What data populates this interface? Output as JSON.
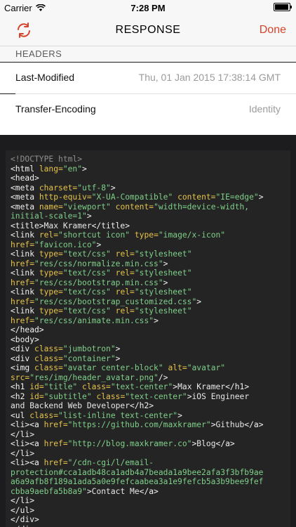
{
  "status_bar": {
    "carrier": "Carrier",
    "time": "7:28 PM"
  },
  "nav": {
    "title": "RESPONSE",
    "done_label": "Done"
  },
  "section": {
    "headers_label": "HEADERS"
  },
  "headers": [
    {
      "key": "Last-Modified",
      "value": "Thu, 01 Jan 2015 17:38:14 GMT"
    },
    {
      "key": "Transfer-Encoding",
      "value": "Identity"
    }
  ],
  "code_lines": [
    [
      [
        "<!DOCTYPE html>",
        "grey"
      ]
    ],
    [
      [
        "<html ",
        "tag"
      ],
      [
        "lang=",
        "attr"
      ],
      [
        "\"en\"",
        "str"
      ],
      [
        ">",
        "tag"
      ]
    ],
    [
      [
        "<head>",
        "tag"
      ]
    ],
    [
      [
        "<meta ",
        "tag"
      ],
      [
        "charset=",
        "attr"
      ],
      [
        "\"utf-8\"",
        "str"
      ],
      [
        ">",
        "tag"
      ]
    ],
    [
      [
        "<meta ",
        "tag"
      ],
      [
        "http-equiv=",
        "attr"
      ],
      [
        "\"X-UA-Compatible\" ",
        "str"
      ],
      [
        "content=",
        "attr"
      ],
      [
        "\"IE=edge\"",
        "str"
      ],
      [
        ">",
        "tag"
      ]
    ],
    [
      [
        "<meta ",
        "tag"
      ],
      [
        "name=",
        "attr"
      ],
      [
        "\"viewport\" ",
        "str"
      ],
      [
        "content=",
        "attr"
      ],
      [
        "\"width=device-width,",
        "str"
      ]
    ],
    [
      [
        "initial-scale=1\"",
        "str"
      ],
      [
        ">",
        "tag"
      ]
    ],
    [
      [
        "<title>",
        "tag"
      ],
      [
        "Max Kramer",
        "text"
      ],
      [
        "</title>",
        "tag"
      ]
    ],
    [
      [
        "<link ",
        "tag"
      ],
      [
        "rel=",
        "attr"
      ],
      [
        "\"shortcut icon\" ",
        "str"
      ],
      [
        "type=",
        "attr"
      ],
      [
        "\"image/x-icon\"",
        "str"
      ]
    ],
    [
      [
        "href=",
        "attr"
      ],
      [
        "\"favicon.ico\"",
        "str"
      ],
      [
        ">",
        "tag"
      ]
    ],
    [
      [
        "<link ",
        "tag"
      ],
      [
        "type=",
        "attr"
      ],
      [
        "\"text/css\" ",
        "str"
      ],
      [
        "rel=",
        "attr"
      ],
      [
        "\"stylesheet\"",
        "str"
      ]
    ],
    [
      [
        "href=",
        "attr"
      ],
      [
        "\"res/css/normalize.min.css\"",
        "str"
      ],
      [
        ">",
        "tag"
      ]
    ],
    [
      [
        "<link ",
        "tag"
      ],
      [
        "type=",
        "attr"
      ],
      [
        "\"text/css\" ",
        "str"
      ],
      [
        "rel=",
        "attr"
      ],
      [
        "\"stylesheet\"",
        "str"
      ]
    ],
    [
      [
        "href=",
        "attr"
      ],
      [
        "\"res/css/bootstrap.min.css\"",
        "str"
      ],
      [
        ">",
        "tag"
      ]
    ],
    [
      [
        "<link ",
        "tag"
      ],
      [
        "type=",
        "attr"
      ],
      [
        "\"text/css\" ",
        "str"
      ],
      [
        "rel=",
        "attr"
      ],
      [
        "\"stylesheet\"",
        "str"
      ]
    ],
    [
      [
        "href=",
        "attr"
      ],
      [
        "\"res/css/bootstrap_customized.css\"",
        "str"
      ],
      [
        ">",
        "tag"
      ]
    ],
    [
      [
        "<link ",
        "tag"
      ],
      [
        "type=",
        "attr"
      ],
      [
        "\"text/css\" ",
        "str"
      ],
      [
        "rel=",
        "attr"
      ],
      [
        "\"stylesheet\"",
        "str"
      ]
    ],
    [
      [
        "href=",
        "attr"
      ],
      [
        "\"res/css/animate.min.css\"",
        "str"
      ],
      [
        ">",
        "tag"
      ]
    ],
    [
      [
        "</head>",
        "tag"
      ]
    ],
    [
      [
        "<body>",
        "tag"
      ]
    ],
    [
      [
        "<div ",
        "tag"
      ],
      [
        "class=",
        "attr"
      ],
      [
        "\"jumbotron\"",
        "str"
      ],
      [
        ">",
        "tag"
      ]
    ],
    [
      [
        "<div ",
        "tag"
      ],
      [
        "class=",
        "attr"
      ],
      [
        "\"container\"",
        "str"
      ],
      [
        ">",
        "tag"
      ]
    ],
    [
      [
        "<img ",
        "tag"
      ],
      [
        "class=",
        "attr"
      ],
      [
        "\"avatar center-block\" ",
        "str"
      ],
      [
        "alt=",
        "attr"
      ],
      [
        "\"avatar\"",
        "str"
      ]
    ],
    [
      [
        "src=",
        "attr"
      ],
      [
        "\"res/img/header_avatar.png\"",
        "str"
      ],
      [
        "/>",
        "tag"
      ]
    ],
    [
      [
        "<h1 ",
        "tag"
      ],
      [
        "id=",
        "attr"
      ],
      [
        "\"title\" ",
        "str"
      ],
      [
        "class=",
        "attr"
      ],
      [
        "\"text-center\"",
        "str"
      ],
      [
        ">",
        "tag"
      ],
      [
        "Max Kramer",
        "text"
      ],
      [
        "</h1>",
        "tag"
      ]
    ],
    [
      [
        "<h2 ",
        "tag"
      ],
      [
        "id=",
        "attr"
      ],
      [
        "\"subtitle\" ",
        "str"
      ],
      [
        "class=",
        "attr"
      ],
      [
        "\"text-center\"",
        "str"
      ],
      [
        ">",
        "tag"
      ],
      [
        "iOS Engineer",
        "text"
      ]
    ],
    [
      [
        "and Backend Web Developer",
        "text"
      ],
      [
        "</h2>",
        "tag"
      ]
    ],
    [
      [
        "<ul ",
        "tag"
      ],
      [
        "class=",
        "attr"
      ],
      [
        "\"list-inline text-center\"",
        "str"
      ],
      [
        ">",
        "tag"
      ]
    ],
    [
      [
        "<li>",
        "tag"
      ],
      [
        "<a ",
        "tag"
      ],
      [
        "href=",
        "attr"
      ],
      [
        "\"https://github.com/maxkramer\"",
        "str"
      ],
      [
        ">",
        "tag"
      ],
      [
        "Github",
        "text"
      ],
      [
        "</a>",
        "tag"
      ]
    ],
    [
      [
        "</li>",
        "tag"
      ]
    ],
    [
      [
        "<li>",
        "tag"
      ],
      [
        "<a ",
        "tag"
      ],
      [
        "href=",
        "attr"
      ],
      [
        "\"http://blog.maxkramer.co\"",
        "str"
      ],
      [
        ">",
        "tag"
      ],
      [
        "Blog",
        "text"
      ],
      [
        "</a>",
        "tag"
      ]
    ],
    [
      [
        "</li>",
        "tag"
      ]
    ],
    [
      [
        "<li>",
        "tag"
      ],
      [
        "<a ",
        "tag"
      ],
      [
        "href=",
        "attr"
      ],
      [
        "\"/cdn-cgi/l/email-",
        "str"
      ]
    ],
    [
      [
        "protection#cca1adb48ca1adb4a7beada1a9bee2afa3f3bfb9ae",
        "str"
      ]
    ],
    [
      [
        "a6a9afb8f189a1ada5a0e9fefcaabea3a1e9fefcb5a3b9bee9fef",
        "str"
      ]
    ],
    [
      [
        "cbba9aebfa5b8a9\"",
        "str"
      ],
      [
        ">",
        "tag"
      ],
      [
        "Contact Me",
        "text"
      ],
      [
        "</a>",
        "tag"
      ]
    ],
    [
      [
        "</li>",
        "tag"
      ]
    ],
    [
      [
        "</ul>",
        "tag"
      ]
    ],
    [
      [
        "</div>",
        "tag"
      ]
    ],
    [
      [
        "</div>",
        "tag"
      ]
    ]
  ],
  "colors": {
    "accent": "#d5432b",
    "code_bg": "#242424",
    "attr": "#e6c34a",
    "string": "#7fd08a"
  }
}
